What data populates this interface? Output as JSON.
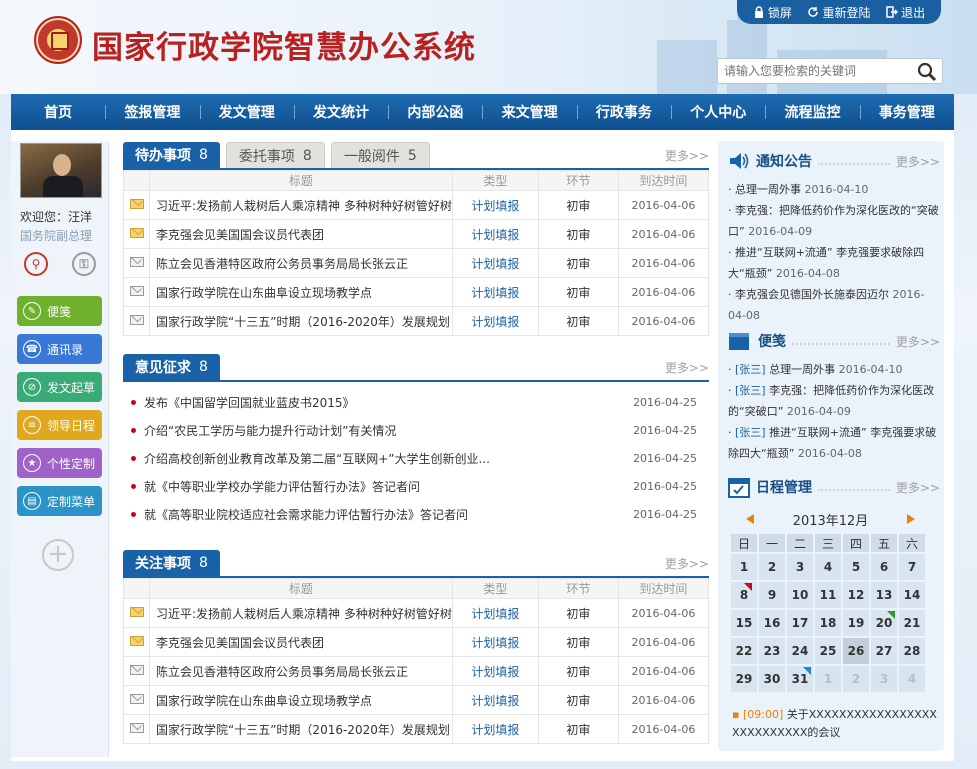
{
  "header": {
    "title": "国家行政学院智慧办公系统",
    "lock": "锁屏",
    "relogin": "重新登陆",
    "logout": "退出",
    "search_placeholder": "请输入您要检索的关键词"
  },
  "nav": [
    "首页",
    "签报管理",
    "发文管理",
    "发文统计",
    "内部公函",
    "来文管理",
    "行政事务",
    "个人中心",
    "流程监控",
    "事务管理"
  ],
  "user": {
    "welcome": "欢迎您：汪洋",
    "role": "国务院副总理"
  },
  "quick": [
    {
      "label": "便笺",
      "color": "#6fb12d",
      "icon": "✎"
    },
    {
      "label": "通讯录",
      "color": "#3a78d8",
      "icon": "☎"
    },
    {
      "label": "发文起草",
      "color": "#3aab77",
      "icon": "⊘"
    },
    {
      "label": "领导日程",
      "color": "#e0a81e",
      "icon": "≡"
    },
    {
      "label": "个性定制",
      "color": "#a062c8",
      "icon": "★"
    },
    {
      "label": "定制菜单",
      "color": "#2a93c8",
      "icon": "▤"
    }
  ],
  "todo": {
    "tabs": [
      {
        "label": "待办事项",
        "count": "8"
      },
      {
        "label": "委托事项",
        "count": "8"
      },
      {
        "label": "一般阅件",
        "count": "5"
      }
    ],
    "more": "更多>>",
    "columns": [
      "标题",
      "类型",
      "环节",
      "到达时间"
    ],
    "rows": [
      {
        "icon": "mail-new",
        "title": "习近平:发扬前人栽树后人乘凉精神 多种树种好树管好树",
        "type": "计划填报",
        "stage": "初审",
        "date": "2016-04-06"
      },
      {
        "icon": "mail-new",
        "title": "李克强会见美国国会议员代表团",
        "type": "计划填报",
        "stage": "初审",
        "date": "2016-04-06"
      },
      {
        "icon": "mail-open",
        "title": "陈立会见香港特区政府公务员事务局局长张云正",
        "type": "计划填报",
        "stage": "初审",
        "date": "2016-04-06"
      },
      {
        "icon": "mail-open",
        "title": "国家行政学院在山东曲阜设立现场教学点",
        "type": "计划填报",
        "stage": "初审",
        "date": "2016-04-06"
      },
      {
        "icon": "mail-open",
        "title": "国家行政学院“十三五”时期（2016-2020年）发展规划",
        "type": "计划填报",
        "stage": "初审",
        "date": "2016-04-06"
      }
    ]
  },
  "opinion": {
    "label": "意见征求",
    "count": "8",
    "more": "更多>>",
    "items": [
      {
        "title": "发布《中国留学回国就业蓝皮书2015》",
        "date": "2016-04-25"
      },
      {
        "title": "介绍“农民工学历与能力提升行动计划”有关情况",
        "date": "2016-04-25"
      },
      {
        "title": "介绍高校创新创业教育改革及第二届“互联网+”大学生创新创业...",
        "date": "2016-04-25"
      },
      {
        "title": "就《中等职业学校办学能力评估暂行办法》答记者问",
        "date": "2016-04-25"
      },
      {
        "title": "就《高等职业院校适应社会需求能力评估暂行办法》答记者问",
        "date": "2016-04-25"
      }
    ]
  },
  "focus": {
    "label": "关注事项",
    "count": "8",
    "more": "更多>>",
    "columns": [
      "标题",
      "类型",
      "环节",
      "到达时间"
    ],
    "rows": [
      {
        "icon": "mail-new",
        "title": "习近平:发扬前人栽树后人乘凉精神 多种树种好树管好树",
        "type": "计划填报",
        "stage": "初审",
        "date": "2016-04-06"
      },
      {
        "icon": "mail-new",
        "title": "李克强会见美国国会议员代表团",
        "type": "计划填报",
        "stage": "初审",
        "date": "2016-04-06"
      },
      {
        "icon": "mail-open",
        "title": "陈立会见香港特区政府公务员事务局局长张云正",
        "type": "计划填报",
        "stage": "初审",
        "date": "2016-04-06"
      },
      {
        "icon": "mail-open",
        "title": "国家行政学院在山东曲阜设立现场教学点",
        "type": "计划填报",
        "stage": "初审",
        "date": "2016-04-06"
      },
      {
        "icon": "mail-open",
        "title": "国家行政学院“十三五”时期（2016-2020年）发展规划",
        "type": "计划填报",
        "stage": "初审",
        "date": "2016-04-06"
      }
    ]
  },
  "notice": {
    "title": "通知公告",
    "more": "更多>>",
    "items": [
      {
        "text": "总理一周外事",
        "date": "2016-04-10"
      },
      {
        "text": "李克强：把降低药价作为深化医改的“突破口”",
        "date": "2016-04-09"
      },
      {
        "text": "推进“互联网+流通” 李克强要求破除四大“瓶颈”",
        "date": "2016-04-08"
      },
      {
        "text": "李克强会见德国外长施泰因迈尔",
        "date": "2016-04-08"
      }
    ]
  },
  "memo": {
    "title": "便笺",
    "more": "更多>>",
    "items": [
      {
        "tag": "[张三]",
        "text": "总理一周外事",
        "date": "2016-04-10"
      },
      {
        "tag": "[张三]",
        "text": "李克强：把降低药价作为深化医改的“突破口”",
        "date": "2016-04-09"
      },
      {
        "tag": "[张三]",
        "text": "推进“互联网+流通” 李克强要求破除四大“瓶颈”",
        "date": "2016-04-08"
      }
    ]
  },
  "schedule": {
    "title": "日程管理",
    "more": "更多>>",
    "month": "2013年12月",
    "weekdays": [
      "日",
      "一",
      "二",
      "三",
      "四",
      "五",
      "六"
    ],
    "days": [
      "1",
      "2",
      "3",
      "4",
      "5",
      "6",
      "7",
      "8",
      "9",
      "10",
      "11",
      "12",
      "13",
      "14",
      "15",
      "16",
      "17",
      "18",
      "19",
      "20",
      "21",
      "22",
      "23",
      "24",
      "25",
      "26",
      "27",
      "28",
      "29",
      "30",
      "31",
      "1",
      "2",
      "3",
      "4"
    ],
    "event_time": "[09:00]",
    "event_text": "关于XXXXXXXXXXXXXXXXXXXXXXXXXXX的会议"
  },
  "colors": {
    "primary": "#1a62a8",
    "brand_red": "#b8211f",
    "accent_orange": "#e8820c"
  }
}
